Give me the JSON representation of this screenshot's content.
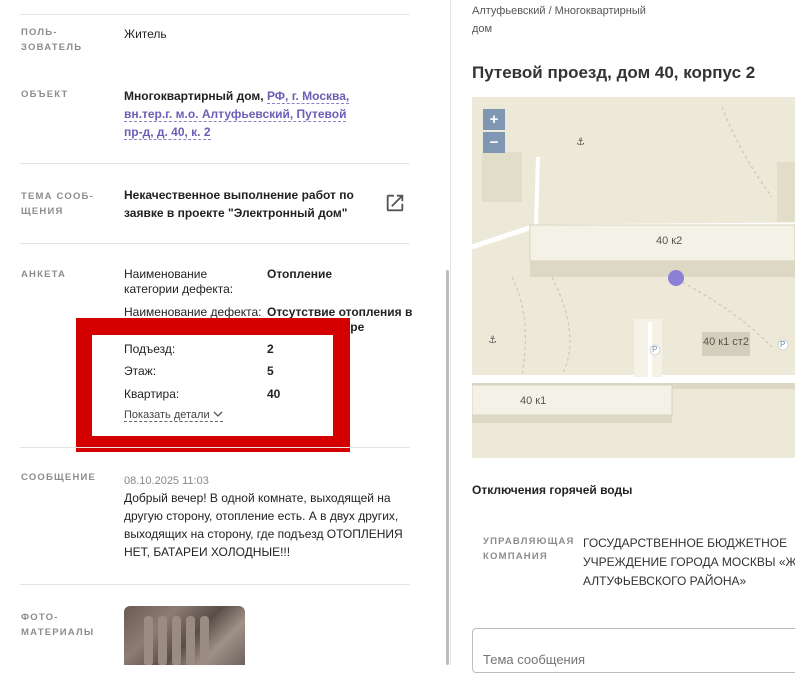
{
  "left": {
    "user": {
      "label_line1": "ПОЛЬ-",
      "label_line2": "ЗОВАТЕЛЬ",
      "value": "Житель"
    },
    "object": {
      "label": "ОБЪЕКТ",
      "value_prefix": "Многоквартирный дом, ",
      "address_line1": "РФ, г. Москва,",
      "address_line2": "вн.тер.г. м.о. Алтуфьевский, Путевой",
      "address_line3": "пр-д, д. 40, к. 2"
    },
    "topic": {
      "label_line1": "ТЕМА СООБ-",
      "label_line2": "ЩЕНИЯ",
      "value_line1": "Некачественное выполнение работ по",
      "value_line2": "заявке в проекте \"Электронный дом\""
    },
    "survey": {
      "label": "АНКЕТА",
      "rows": [
        {
          "name_line1": "Наименование",
          "name_line2": "категории дефекта:",
          "value_line1": "Отопление",
          "value_line2": ""
        },
        {
          "name_line1": "Наименование дефекта:",
          "name_line2": "",
          "value_line1": "Отсутствие отопления в",
          "value_line2": "тире"
        }
      ],
      "entrance": {
        "name": "Подъезд:",
        "value": "2"
      },
      "floor": {
        "name": "Этаж:",
        "value": "5"
      },
      "apartment": {
        "name": "Квартира:",
        "value": "40"
      },
      "details_link": "Показать детали"
    },
    "message": {
      "label": "СООБЩЕНИЕ",
      "timestamp": "08.10.2025 11:03",
      "line1": "Добрый вечер! В одной комнате, выходящей на",
      "line2": "другую сторону, отопление есть. А в двух других,",
      "line3": "выходящих на сторону, где подъезд ОТОПЛЕНИЯ",
      "line4": "НЕТ, БАТАРЕИ ХОЛОДНЫЕ!!!"
    },
    "photos": {
      "label_line1": "ФОТО-",
      "label_line2": "МАТЕРИАЛЫ"
    }
  },
  "right": {
    "breadcrumb_line1": "Алтуфьевский / Многоквартирный",
    "breadcrumb_line2": "дом",
    "title": "Путевой проезд, дом 40, корпус 2",
    "map": {
      "zoom_in": "+",
      "zoom_out": "−",
      "label_40k2": "40 к2",
      "label_40k1st2": "40 к1 ст2",
      "label_40k1": "40 к1",
      "parking": "P",
      "marker_color": "#8c7fd6"
    },
    "hot_water": "Отключения горячей воды",
    "hot_water_cut": "",
    "manager": {
      "label_line1": "УПРАВЛЯЮЩАЯ",
      "label_line2": "КОМПАНИЯ",
      "line1": "ГОСУДАРСТВЕННОЕ БЮДЖЕТНОЕ",
      "line2": "УЧРЕЖДЕНИЕ ГОРОДА МОСКВЫ «Ж",
      "line3": "АЛТУФЬЕВСКОГО РАЙОНА»"
    },
    "subject_placeholder": "Тема сообщения"
  },
  "colors": {
    "accent_link": "#6a5fb5",
    "highlight_box": "#d40000",
    "map_bg": "#ede9d8"
  }
}
